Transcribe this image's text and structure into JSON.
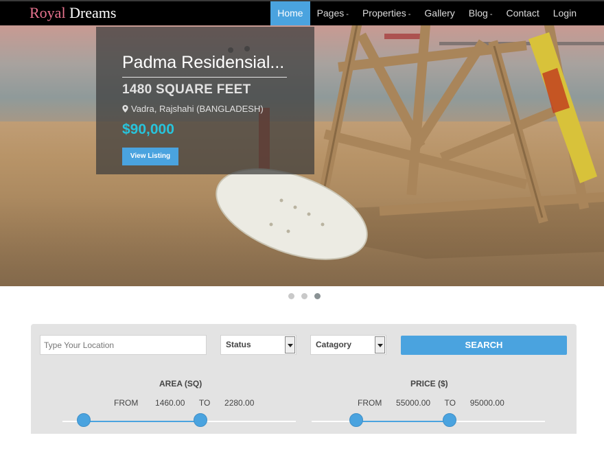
{
  "brand": {
    "part1": "Royal",
    "part2": "Dreams"
  },
  "nav": {
    "items": [
      {
        "label": "Home",
        "active": true,
        "caret": ""
      },
      {
        "label": "Pages",
        "active": false,
        "caret": "-"
      },
      {
        "label": "Properties",
        "active": false,
        "caret": "-"
      },
      {
        "label": "Gallery",
        "active": false,
        "caret": ""
      },
      {
        "label": "Blog",
        "active": false,
        "caret": "-"
      },
      {
        "label": "Contact",
        "active": false,
        "caret": ""
      },
      {
        "label": "Login",
        "active": false,
        "caret": ""
      }
    ]
  },
  "slide": {
    "title": "Padma Residensial...",
    "size": "1480 SQUARE FEET",
    "location": "Vadra, Rajshahi (BANGLADESH)",
    "price": "$90,000",
    "button": "View Listing",
    "location_icon": "map-marker-icon"
  },
  "carousel": {
    "count": 3,
    "active_index": 2
  },
  "search": {
    "location_placeholder": "Type Your Location",
    "status_label": "Status",
    "category_label": "Catagory",
    "search_button": "SEARCH",
    "area": {
      "title": "AREA (SQ)",
      "from_label": "FROM",
      "from_value": "1460.00",
      "to_label": "TO",
      "to_value": "2280.00",
      "from_fraction": 0.09,
      "to_fraction": 0.59
    },
    "price": {
      "title": "PRICE ($)",
      "from_label": "FROM",
      "from_value": "55000.00",
      "to_label": "TO",
      "to_value": "95000.00",
      "from_fraction": 0.19,
      "to_fraction": 0.59
    }
  },
  "colors": {
    "accent": "#4aa3df",
    "brand_accent": "#e8738f",
    "price": "#27c4dc"
  }
}
